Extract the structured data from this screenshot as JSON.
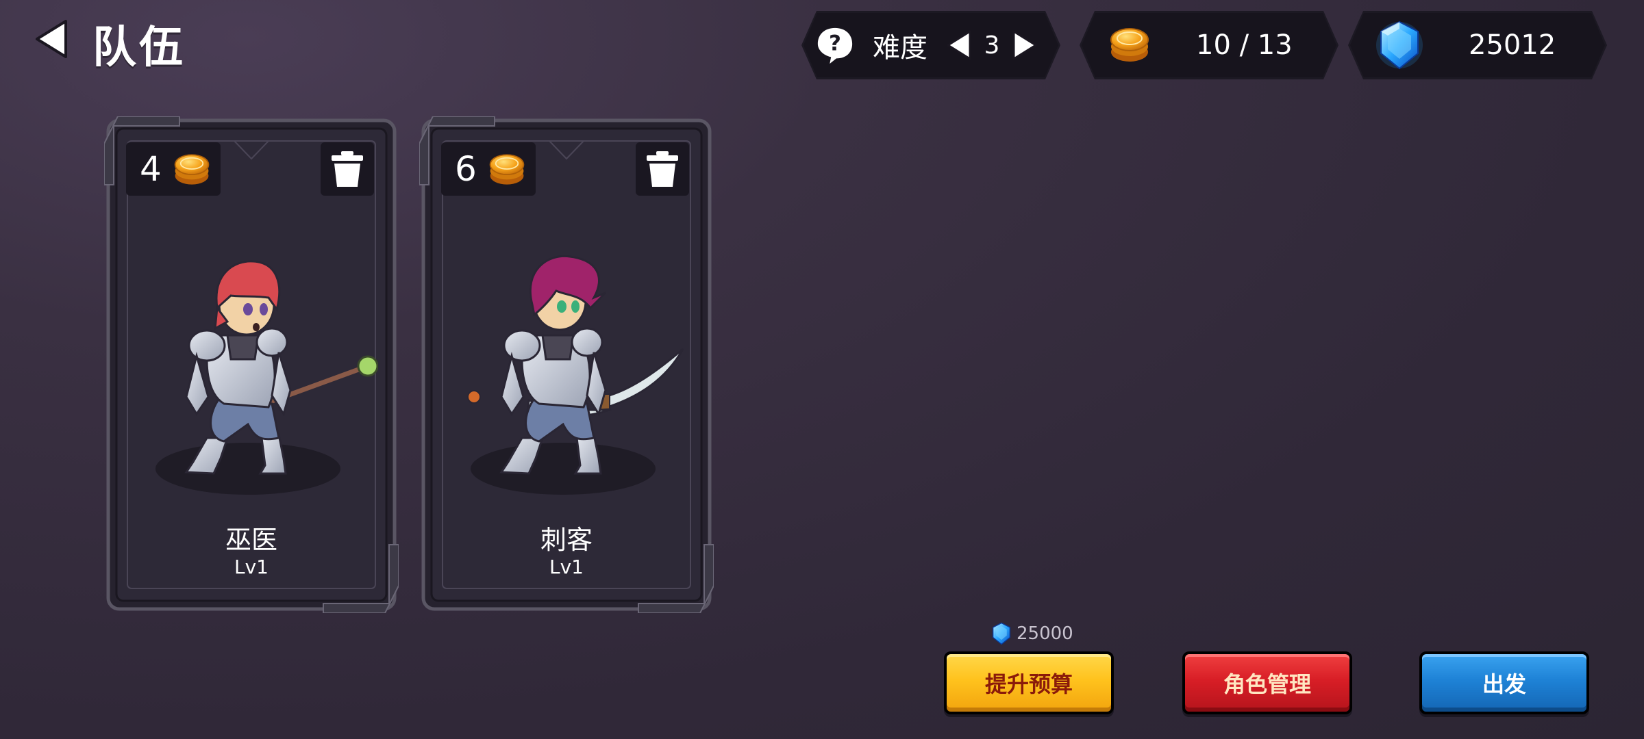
{
  "header": {
    "title": "队伍",
    "difficulty_label": "难度",
    "difficulty_value": "3",
    "gold": "10 / 13",
    "gems": "25012"
  },
  "cards": [
    {
      "cost": "4",
      "name": "巫医",
      "level": "Lv1",
      "hair_color": "#d94a50",
      "weapon": "staff"
    },
    {
      "cost": "6",
      "name": "刺客",
      "level": "Lv1",
      "hair_color": "#a0236a",
      "weapon": "dual-blades"
    }
  ],
  "budget_upgrade": {
    "gem_cost": "25000",
    "label": "提升预算"
  },
  "buttons": {
    "role_manage": "角色管理",
    "depart": "出发"
  },
  "colors": {
    "gold_coin": "#f6a21a",
    "gem": "#2aa8ff",
    "budget_button": "#ffc21d",
    "roles_button": "#d81e26",
    "depart_button": "#1e82d6"
  }
}
